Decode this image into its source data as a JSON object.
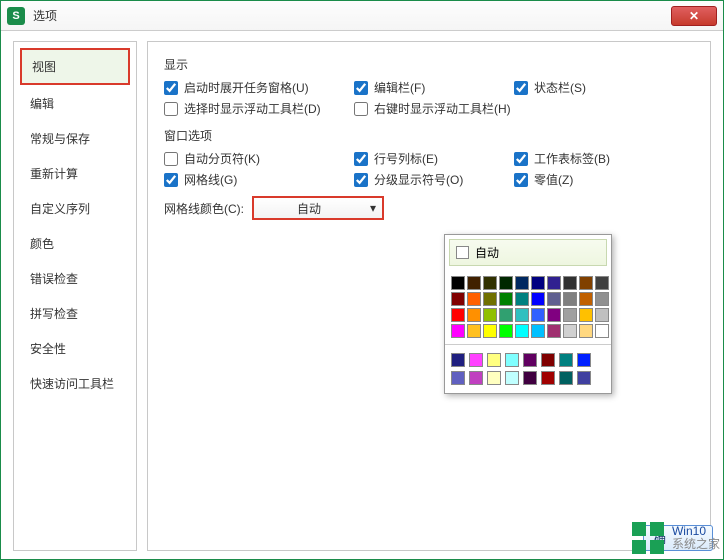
{
  "titlebar": {
    "title": "选项",
    "close_icon": "✕",
    "app_icon_letter": "S"
  },
  "sidebar": {
    "items": [
      {
        "label": "视图",
        "selected": true
      },
      {
        "label": "编辑"
      },
      {
        "label": "常规与保存"
      },
      {
        "label": "重新计算"
      },
      {
        "label": "自定义序列"
      },
      {
        "label": "颜色"
      },
      {
        "label": "错误检查"
      },
      {
        "label": "拼写检查"
      },
      {
        "label": "安全性"
      },
      {
        "label": "快速访问工具栏"
      }
    ]
  },
  "sections": {
    "display": {
      "title": "显示",
      "row1": [
        {
          "label": "启动时展开任务窗格(U)",
          "checked": true
        },
        {
          "label": "编辑栏(F)",
          "checked": true
        },
        {
          "label": "状态栏(S)",
          "checked": true
        }
      ],
      "row2": [
        {
          "label": "选择时显示浮动工具栏(D)",
          "checked": false
        },
        {
          "label": "右键时显示浮动工具栏(H)",
          "checked": false
        }
      ]
    },
    "window": {
      "title": "窗口选项",
      "row1": [
        {
          "label": "自动分页符(K)",
          "checked": false
        },
        {
          "label": "行号列标(E)",
          "checked": true
        },
        {
          "label": "工作表标签(B)",
          "checked": true
        }
      ],
      "row2": [
        {
          "label": "网格线(G)",
          "checked": true
        },
        {
          "label": "分级显示符号(O)",
          "checked": true
        },
        {
          "label": "零值(Z)",
          "checked": true
        }
      ],
      "gridcolor": {
        "label": "网格线颜色(C):",
        "value": "自动"
      }
    }
  },
  "color_popup": {
    "auto_label": "自动",
    "main_colors": [
      "#000000",
      "#402000",
      "#303000",
      "#002800",
      "#002860",
      "#000080",
      "#302090",
      "#303030",
      "#804000",
      "#404040",
      "#800000",
      "#ff6000",
      "#707000",
      "#008000",
      "#008080",
      "#0000ff",
      "#606090",
      "#808080",
      "#c06000",
      "#909090",
      "#ff0000",
      "#ff9000",
      "#90c000",
      "#30a070",
      "#30c0c0",
      "#3060ff",
      "#800080",
      "#a0a0a0",
      "#ffc000",
      "#c0c0c0",
      "#ff00ff",
      "#ffc020",
      "#ffff00",
      "#00ff00",
      "#00ffff",
      "#00c0ff",
      "#a03070",
      "#d0d0d0",
      "#ffd880",
      "#ffffff"
    ],
    "extra_colors": [
      "#202080",
      "#ff40ff",
      "#ffff80",
      "#80ffff",
      "#600060",
      "#800000",
      "#008080",
      "#0020ff",
      "#6060c0",
      "#c040c0",
      "#ffffc0",
      "#c0ffff",
      "#400040",
      "#a00000",
      "#006060",
      "#4040a0"
    ]
  },
  "footer": {
    "ok_label": "确"
  },
  "watermark": {
    "line1": "Win10",
    "line2": "系统之家",
    "url": ""
  }
}
